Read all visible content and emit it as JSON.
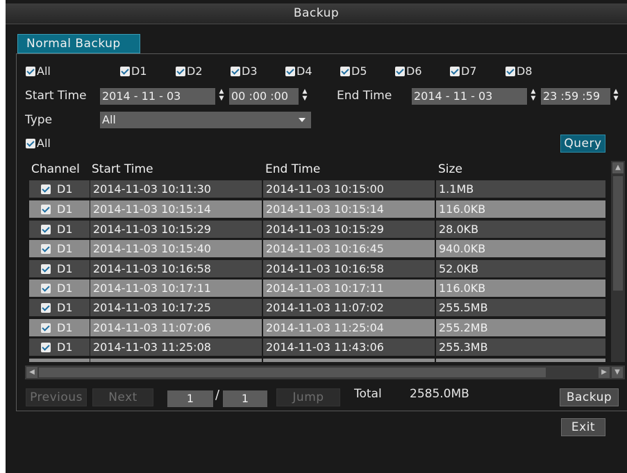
{
  "window": {
    "title": "Backup"
  },
  "tab": {
    "label": "Normal Backup"
  },
  "channels": {
    "all_label": "All",
    "items": [
      "D1",
      "D2",
      "D3",
      "D4",
      "D5",
      "D6",
      "D7",
      "D8"
    ]
  },
  "time": {
    "start_label": "Start Time",
    "start_date": "2014 -  11 -  03",
    "start_time": "00 :00 :00",
    "end_label": "End Time",
    "end_date": "2014 -  11 -  03",
    "end_time": "23 :59 :59"
  },
  "type": {
    "label": "Type",
    "value": "All"
  },
  "select_all": {
    "label": "All"
  },
  "query_button": "Query",
  "table": {
    "headers": [
      "Channel",
      "Start Time",
      "End Time",
      "Size"
    ],
    "rows": [
      {
        "channel": "D1",
        "start": "2014-11-03 10:11:30",
        "end": "2014-11-03 10:15:00",
        "size": "1.1MB"
      },
      {
        "channel": "D1",
        "start": "2014-11-03 10:15:14",
        "end": "2014-11-03 10:15:14",
        "size": "116.0KB"
      },
      {
        "channel": "D1",
        "start": "2014-11-03 10:15:29",
        "end": "2014-11-03 10:15:29",
        "size": "28.0KB"
      },
      {
        "channel": "D1",
        "start": "2014-11-03 10:15:40",
        "end": "2014-11-03 10:16:45",
        "size": "940.0KB"
      },
      {
        "channel": "D1",
        "start": "2014-11-03 10:16:58",
        "end": "2014-11-03 10:16:58",
        "size": "52.0KB"
      },
      {
        "channel": "D1",
        "start": "2014-11-03 10:17:11",
        "end": "2014-11-03 10:17:11",
        "size": "116.0KB"
      },
      {
        "channel": "D1",
        "start": "2014-11-03 10:17:25",
        "end": "2014-11-03 11:07:02",
        "size": "255.5MB"
      },
      {
        "channel": "D1",
        "start": "2014-11-03 11:07:06",
        "end": "2014-11-03 11:25:04",
        "size": "255.2MB"
      },
      {
        "channel": "D1",
        "start": "2014-11-03 11:25:08",
        "end": "2014-11-03 11:43:06",
        "size": "255.3MB"
      }
    ]
  },
  "pagination": {
    "previous": "Previous",
    "next": "Next",
    "current_page": "1",
    "separator": "/",
    "total_pages": "1",
    "jump": "Jump"
  },
  "total": {
    "label": "Total",
    "value": "2585.0MB"
  },
  "backup_button": "Backup",
  "exit_button": "Exit",
  "colors": {
    "accent": "#0c6d86",
    "background": "#1a1a1a",
    "row_light": "#8b8b8b",
    "row_dark": "#484848"
  }
}
